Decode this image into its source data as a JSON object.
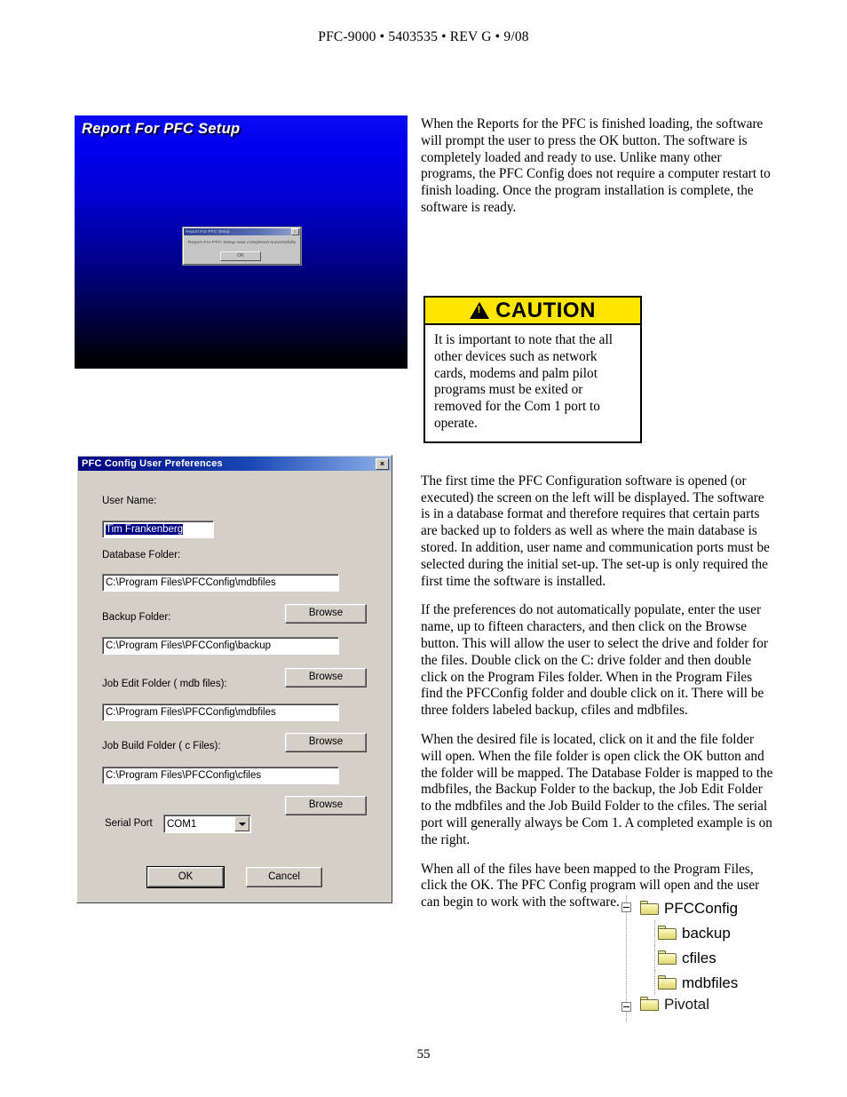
{
  "header": {
    "text": "PFC-9000 • 5403535 • REV G • 9/08"
  },
  "footer": {
    "page_number": "55"
  },
  "splash": {
    "title": "Report For PFC Setup",
    "dialog": {
      "title": "Report For PFC Setup",
      "message": "Report For PFC Setup was completed successfully",
      "ok_label": "OK",
      "close_label": "×"
    },
    "colors": {
      "top": "#0000FF",
      "bottom": "#000000"
    }
  },
  "caution": {
    "heading": "CAUTION",
    "body": "It is important to note that the all other devices such as network cards, modems and palm pilot programs must be exited or removed for the Com 1 port to operate.",
    "banner_color": "#FFE600"
  },
  "dialog": {
    "title": "PFC Config User Preferences",
    "close_label": "×",
    "labels": {
      "user_name": "User Name:",
      "database_folder": "Database Folder:",
      "backup_folder": "Backup Folder:",
      "job_edit_folder": "Job Edit Folder ( mdb files):",
      "job_build_folder": "Job Build Folder ( c Files):",
      "serial_port": "Serial Port"
    },
    "values": {
      "user_name": "Tim Frankenberg",
      "database_folder": "C:\\Program Files\\PFCConfig\\mdbfiles",
      "backup_folder": "C:\\Program Files\\PFCConfig\\backup",
      "job_edit_folder": "C:\\Program Files\\PFCConfig\\mdbfiles",
      "job_build_folder": "C:\\Program Files\\PFCConfig\\cfiles",
      "serial_port": "COM1"
    },
    "buttons": {
      "browse": "Browse",
      "ok": "OK",
      "cancel": "Cancel"
    }
  },
  "body": {
    "paragraphs": [
      "When the Reports for the PFC is finished loading, the software will prompt the user to press the OK button. The software is completely loaded and ready to use. Unlike many other programs, the PFC Config does not require a computer restart to finish loading. Once the program installation is complete, the software is ready.",
      "The first time the PFC Configuration software is opened (or executed) the screen on the left will be displayed. The software is in a database format and therefore requires that certain parts are backed up to folders as well as where the main database is stored. In addition, user name and communication ports must be selected during the initial set-up. The set-up is only required the first time the software is installed.",
      "If the preferences do not automatically populate, enter the user name, up to fifteen characters, and then click on the Browse button. This will allow the user to select the drive and folder for the files. Double click on the C: drive folder and then double click on the Program Files folder. When in the Program Files find the PFCConfig folder and double click on it. There will be three folders labeled backup, cfiles and mdbfiles.",
      "When the desired file is located, click on it and the file folder will open. When the file folder is open click the OK button and the folder will be mapped. The Database Folder is mapped to the mdbfiles, the Backup Folder to the backup, the Job Edit Folder to the mdbfiles and the Job Build Folder to the cfiles. The serial port will generally always be Com 1. A completed example is on the right.",
      "When all of the files have been mapped to the Program Files, click the OK. The PFC Config program will open and the user can begin to work with the software."
    ]
  },
  "folder_tree": {
    "root": "PFCConfig",
    "children": [
      "backup",
      "cfiles",
      "mdbfiles"
    ],
    "next_sibling": "Pivotal"
  }
}
